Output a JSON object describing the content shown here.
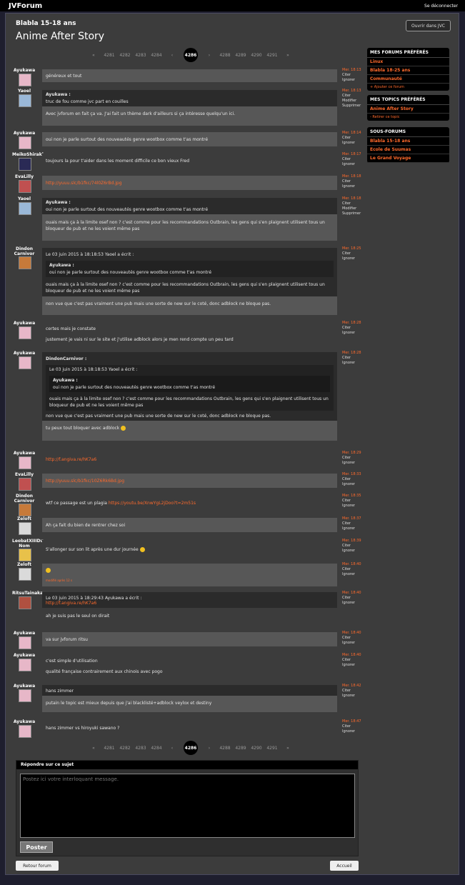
{
  "header": {
    "brand": "JVForum",
    "logout": "Se déconnecter"
  },
  "forum": {
    "name": "Blabla 15-18 ans",
    "topic": "Anime After Story",
    "open_jvc": "Ouvrir dans JVC"
  },
  "pager": {
    "prev_all": "«",
    "pages_before": [
      "4281",
      "4282",
      "4283",
      "4284"
    ],
    "prev": "‹",
    "current": "4286",
    "next": "›",
    "pages_after": [
      "4288",
      "4289",
      "4290",
      "4291"
    ],
    "next_all": "»"
  },
  "meta_labels": {
    "cite": "Citer",
    "ignore": "Ignorer",
    "edit": "Modifier",
    "delete": "Supprimer"
  },
  "posts": [
    {
      "pseudo": "Ayukawa",
      "date": "Mer. 18:13",
      "text": "généreux et tout"
    },
    {
      "pseudo": "Yaoel",
      "date": "Mer. 18:13",
      "quote_head": "Ayukawa :",
      "quote": "truc de fou comme jvc part en couilles",
      "text": "Avec jvforum en fait ça va. J'ai fait un thème dark d'ailleurs si ça intéresse quelqu'un ici."
    },
    {
      "pseudo": "Ayukawa",
      "date": "Mer. 18:14",
      "text": "oui non je parle surtout des nouveautés genre wootbox comme t'as montré"
    },
    {
      "pseudo": "MeikoShiraki",
      "date": "Mer. 18:17",
      "text": "toujours la pour t'aider dans les moment difficile ce bon vieux Fred"
    },
    {
      "pseudo": "EvaLilly",
      "date": "Mer. 18:18",
      "link": "http://yuuu.slc/b1fkc/74l0Z6rBd.jpg"
    },
    {
      "pseudo": "Yaoel",
      "date": "Mer. 18:18",
      "quote_head": "Ayukawa :",
      "quote": "oui non je parle surtout des nouveautés genre wootbox comme t'as montré",
      "text": "ouais mais ça à la limite osef non ? c'est comme pour les recommandations Outbrain, les gens qui s'en plaignent utilisent tous un bloqueur de pub et ne les voient même pas"
    },
    {
      "pseudo": "Dindon Carnivor",
      "date": "Mer. 18:25",
      "quote_head": "Le 03 juin 2015 à 18:18:53 Yaoel a écrit :",
      "inner_head": "Ayukawa :",
      "inner": "oui non je parle surtout des nouveautés genre wootbox comme t'as montré",
      "quote": "ouais mais ça à la limite osef non ? c'est comme pour les recommandations Outbrain, les gens qui s'en plaignent utilisent tous un bloqueur de pub et ne les voient même pas",
      "text": "non vue que c'est pas vraiment une pub mais une sorte de new sur le coté, donc adblock ne bloque pas."
    },
    {
      "pseudo": "Ayukawa",
      "date": "Mer. 18:28",
      "text": "certes mais je constate",
      "text2": "justement je vais ni sur le site et j'utilise adblock alors je men rend compte un peu tard"
    },
    {
      "pseudo": "Ayukawa",
      "date": "Mer. 18:28",
      "quote_head": "DindonCarnivor :",
      "q2": "Le 03 juin 2015 à 18:18:53 Yaoel a écrit :",
      "inner_head": "Ayukawa :",
      "inner": "oui non je parle surtout des nouveautés genre wootbox comme t'as montré",
      "quote": "ouais mais ça à la limite osef non ? c'est comme pour les recommandations Outbrain, les gens qui s'en plaignent utilisent tous un bloqueur de pub et ne les voient même pas",
      "quote2": "non vue que c'est pas vraiment une pub mais une sorte de new sur le coté, donc adblock ne bloque pas.",
      "text": "tu peux tout bloquer avec adblock"
    },
    {
      "pseudo": "Ayukawa",
      "date": "Mer. 18:29",
      "link": "http://f.angiva.re/hK7a6"
    },
    {
      "pseudo": "EvaLilly",
      "date": "Mer. 18:33",
      "link": "http://yuuu.slc/b1fkc/10Z6Rk6Bd.jpg"
    },
    {
      "pseudo": "Dindon Carnivor",
      "date": "Mer. 18:35",
      "text": "wtf ce passage est un plagia",
      "link": "https://youtu.be/XnwYgL2jDoo?t=2m51s"
    },
    {
      "pseudo": "Zeloft",
      "date": "Mer. 18:37",
      "text": "Ah ça fait du bien de rentrer chez soi"
    },
    {
      "pseudo": "LeobatXIIIDu Nom",
      "date": "Mer. 18:39",
      "text": "S'allonger sur son lit après une dur journée"
    },
    {
      "pseudo": "Zeloft",
      "date": "Mer. 18:40",
      "small": "modifié après 12 s"
    },
    {
      "pseudo": "RitsuTainaka",
      "date": "Mer. 18:40",
      "quote_head": "Le 03 juin 2015 à 18:29:43 Ayukawa a écrit :",
      "link": "http://f.angiva.re/hK7a6",
      "text": "ah je suis pas le seul on dirait"
    },
    {
      "pseudo": "Ayukawa",
      "date": "Mer. 18:40",
      "text": "va sur jvforum ritsu"
    },
    {
      "pseudo": "Ayukawa",
      "date": "Mer. 18:40",
      "text": "c'est simple d'utilisation",
      "text2": "qualité française contrairement aux chinois avec pogo"
    },
    {
      "pseudo": "Ayukawa",
      "date": "Mer. 18:42",
      "quote": "hans zimmer",
      "text": "putain le topic est mieux depuis que j'ai blacklisté+adblock veylox et destiny"
    },
    {
      "pseudo": "Ayukawa",
      "date": "Mer. 18:47",
      "text": "hans zimmer vs hiroyuki sawano ?"
    }
  ],
  "sidebar": {
    "fav_forums_title": "MES FORUMS PRÉFÉRÉS",
    "fav_forums": [
      "Linux",
      "Blabla 18-25 ans",
      "Communauté"
    ],
    "add_forum": "+ Ajouter ce forum",
    "fav_topics_title": "MES TOPICS PRÉFÉRÉS",
    "fav_topics": [
      "Anime After Story"
    ],
    "remove_topic": "- Retirer ce topic",
    "subforums_title": "SOUS-FORUMS",
    "subforums": [
      "Blabla 15-18 ans",
      "Ecole de Suumas",
      "Le Grand Voyage"
    ]
  },
  "reply": {
    "title": "Répondre sur ce sujet",
    "placeholder": "Postez ici votre interloquant message.",
    "post": "Poster"
  },
  "footer": {
    "back": "Retour forum",
    "home": "Accueil"
  }
}
